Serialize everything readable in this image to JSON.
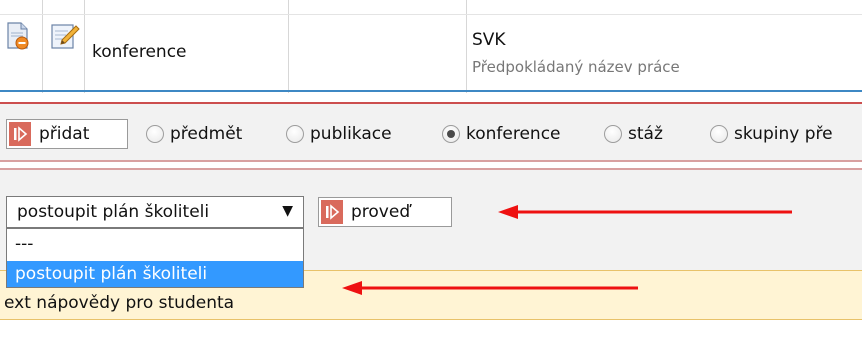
{
  "table": {
    "row": {
      "name": "konference",
      "code": "SVK",
      "subtitle": "Předpokládaný název práce"
    }
  },
  "actions": {
    "add_button": "přidat",
    "radios": [
      {
        "label": "předmět",
        "checked": false
      },
      {
        "label": "publikace",
        "checked": false
      },
      {
        "label": "konference",
        "checked": true
      },
      {
        "label": "stáž",
        "checked": false
      },
      {
        "label": "skupiny pře",
        "checked": false
      }
    ],
    "select": {
      "selected": "postoupit plán školiteli",
      "options": [
        "---",
        "postoupit plán školiteli"
      ],
      "highlighted_index": 1
    },
    "execute_button": "proveď"
  },
  "help": {
    "text": "ext nápovědy pro studenta"
  },
  "colors": {
    "accent_red": "#cc4e4e",
    "selection_blue": "#3399ff",
    "help_background": "#fff4d4",
    "arrow_red": "#ee1111"
  }
}
